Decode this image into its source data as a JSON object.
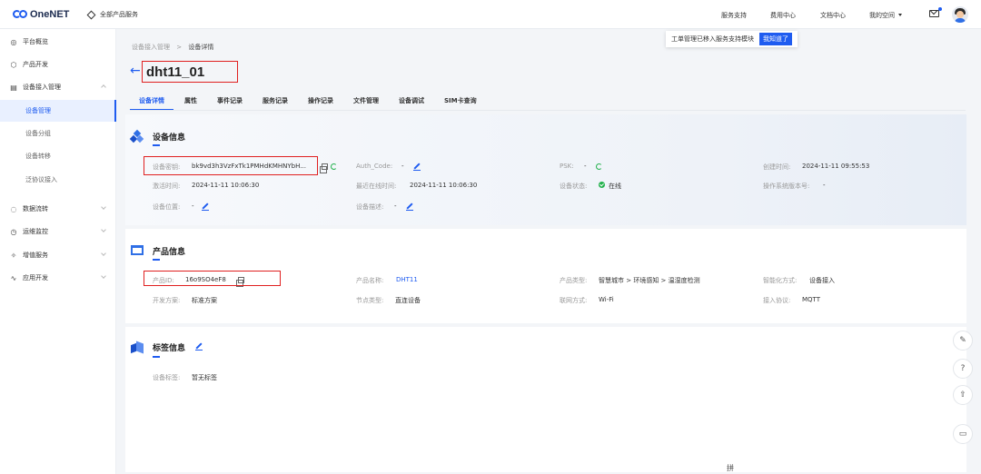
{
  "header": {
    "logo": "OneNET",
    "all_products": "全部产品服务",
    "nav": [
      "服务支持",
      "费用中心",
      "文档中心"
    ],
    "my_space": "我的空间"
  },
  "sidebar": {
    "items": [
      {
        "label": "平台概览",
        "icon": "dashboard-icon",
        "glyph": "◎"
      },
      {
        "label": "产品开发",
        "icon": "product-dev-icon",
        "glyph": "⬡"
      },
      {
        "label": "设备接入管理",
        "icon": "device-access-icon",
        "glyph": "▤"
      },
      {
        "label": "数据流转",
        "icon": "data-flow-icon",
        "glyph": "◌"
      },
      {
        "label": "运维监控",
        "icon": "monitor-icon",
        "glyph": "◷"
      },
      {
        "label": "增值服务",
        "icon": "value-added-icon",
        "glyph": "✧"
      },
      {
        "label": "应用开发",
        "icon": "app-dev-icon",
        "glyph": "∿"
      }
    ],
    "subitems": [
      "设备管理",
      "设备分组",
      "设备转移",
      "泛协议接入"
    ]
  },
  "notice": {
    "text": "工单管理已移入服务支持模块",
    "button": "我知道了"
  },
  "breadcrumb": {
    "parent": "设备接入管理",
    "sep": ">",
    "current": "设备详情"
  },
  "page": {
    "title": "dht11_01"
  },
  "tabs": [
    "设备详情",
    "属性",
    "事件记录",
    "服务记录",
    "操作记录",
    "文件管理",
    "设备调试",
    "SIM卡查询"
  ],
  "device_info": {
    "title": "设备信息",
    "key_label": "设备密钥:",
    "key_value": "bk9vd3h3VzFxTk1PMHdKMHNYbH...",
    "auth_label": "Auth_Code:",
    "auth_value": "-",
    "psk_label": "PSK:",
    "psk_value": "-",
    "created_label": "创建时间:",
    "created_value": "2024-11-11 09:55:53",
    "activated_label": "激活时间:",
    "activated_value": "2024-11-11 10:06:30",
    "last_online_label": "最近在线时间:",
    "last_online_value": "2024-11-11 10:06:30",
    "status_label": "设备状态:",
    "status_value": "在线",
    "os_label": "操作系统版本号:",
    "os_value": "-",
    "location_label": "设备位置:",
    "location_value": "-",
    "desc_label": "设备描述:",
    "desc_value": "-"
  },
  "product_info": {
    "title": "产品信息",
    "id_label": "产品ID:",
    "id_value": "16o9SO4eF8",
    "name_label": "产品名称:",
    "name_value": "DHT11",
    "type_label": "产品类型:",
    "type_value": "智慧城市 > 环境感知 > 温湿度检测",
    "smart_label": "智能化方式:",
    "smart_value": "设备接入",
    "dev_label": "开发方案:",
    "dev_value": "标准方案",
    "node_label": "节点类型:",
    "node_value": "直连设备",
    "net_label": "联网方式:",
    "net_value": "Wi-Fi",
    "protocol_label": "接入协议:",
    "protocol_value": "MQTT"
  },
  "tag_info": {
    "title": "标签信息",
    "tags_label": "设备标签:",
    "tags_value": "暂无标签"
  },
  "ime": "拼",
  "colors": {
    "accent": "#1f5cf0",
    "highlight": "#e02020",
    "online": "#22b14c"
  }
}
